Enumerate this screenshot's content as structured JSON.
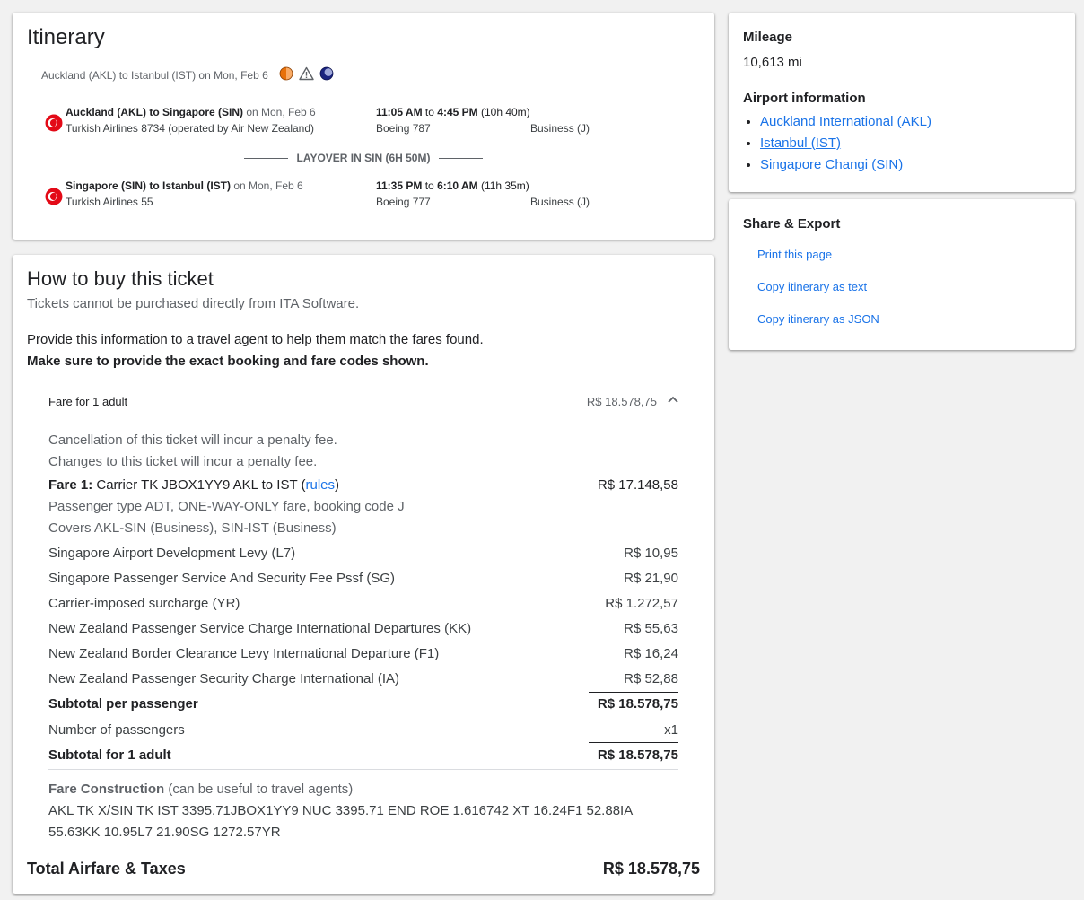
{
  "itinerary": {
    "title": "Itinerary",
    "summary": "Auckland (AKL) to Istanbul (IST) on Mon, Feb 6",
    "summary_icons": [
      "overnight-flight-icon",
      "warning-icon",
      "night-icon"
    ],
    "segments": [
      {
        "route": "Auckland (AKL) to Singapore (SIN)",
        "date": " on Mon, Feb 6",
        "airline": "Turkish Airlines 8734 (operated by Air New Zealand)",
        "dep": "11:05 AM",
        "to": " to ",
        "arr": "4:45 PM",
        "duration": " (10h 40m)",
        "aircraft": "Boeing 787",
        "cabin": "Business (J)"
      },
      {
        "route": "Singapore (SIN) to Istanbul (IST)",
        "date": " on Mon, Feb 6",
        "airline": "Turkish Airlines 55",
        "dep": "11:35 PM",
        "to": " to ",
        "arr": "6:10 AM",
        "duration": " (11h 35m)",
        "aircraft": "Boeing 777",
        "cabin": "Business (J)"
      }
    ],
    "layover": "LAYOVER IN SIN (6H 50M)",
    "airline_color": "#e30a17"
  },
  "buy": {
    "title": "How to buy this ticket",
    "subtitle": "Tickets cannot be purchased directly from ITA Software.",
    "instruction": "Provide this information to a travel agent to help them match the fares found.",
    "instruction_bold": "Make sure to provide the exact booking and fare codes shown.",
    "fare_header": {
      "label": "Fare for 1 adult",
      "amount": "R$ 18.578,75"
    },
    "penalties": [
      "Cancellation of this ticket will incur a penalty fee.",
      "Changes to this ticket will incur a penalty fee."
    ],
    "fare1": {
      "label": "Fare 1:",
      "text": " Carrier TK JBOX1YY9 AKL to IST (",
      "rules": "rules",
      "close": ")",
      "amount": "R$ 17.148,58",
      "line2": "Passenger type ADT, ONE-WAY-ONLY fare, booking code J",
      "line3": "Covers AKL-SIN (Business), SIN-IST (Business)"
    },
    "taxes": [
      {
        "label": "Singapore Airport Development Levy (L7)",
        "amount": "R$ 10,95"
      },
      {
        "label": "Singapore Passenger Service And Security Fee Pssf (SG)",
        "amount": "R$ 21,90"
      },
      {
        "label": "Carrier-imposed surcharge (YR)",
        "amount": "R$ 1.272,57"
      },
      {
        "label": "New Zealand Passenger Service Charge International Departures (KK)",
        "amount": "R$ 55,63"
      },
      {
        "label": "New Zealand Border Clearance Levy International Departure (F1)",
        "amount": "R$ 16,24"
      },
      {
        "label": "New Zealand Passenger Security Charge International (IA)",
        "amount": "R$ 52,88"
      }
    ],
    "subtotal_pp": {
      "label": "Subtotal per passenger",
      "amount": "R$ 18.578,75"
    },
    "num_pax": {
      "label": "Number of passengers",
      "amount": "x1"
    },
    "subtotal_adult": {
      "label": "Subtotal for 1 adult",
      "amount": "R$ 18.578,75"
    },
    "fare_construction": {
      "label": "Fare Construction",
      "note": " (can be useful to travel agents)",
      "line1": "AKL TK X/SIN TK IST 3395.71JBOX1YY9 NUC 3395.71 END ROE 1.616742 XT 16.24F1 52.88IA",
      "line2": "55.63KK 10.95L7 21.90SG 1272.57YR"
    },
    "total": {
      "label": "Total Airfare & Taxes",
      "amount": "R$ 18.578,75"
    }
  },
  "mileage": {
    "title": "Mileage",
    "value": "10,613 mi"
  },
  "airport_info": {
    "title": "Airport information",
    "airports": [
      "Auckland International (AKL)",
      "Istanbul (IST)",
      "Singapore Changi (SIN)"
    ]
  },
  "share": {
    "title": "Share & Export",
    "actions": [
      "Print this page",
      "Copy itinerary as text",
      "Copy itinerary as JSON"
    ]
  },
  "colors": {
    "link": "#1a73e8",
    "text_secondary": "#5f6368"
  }
}
